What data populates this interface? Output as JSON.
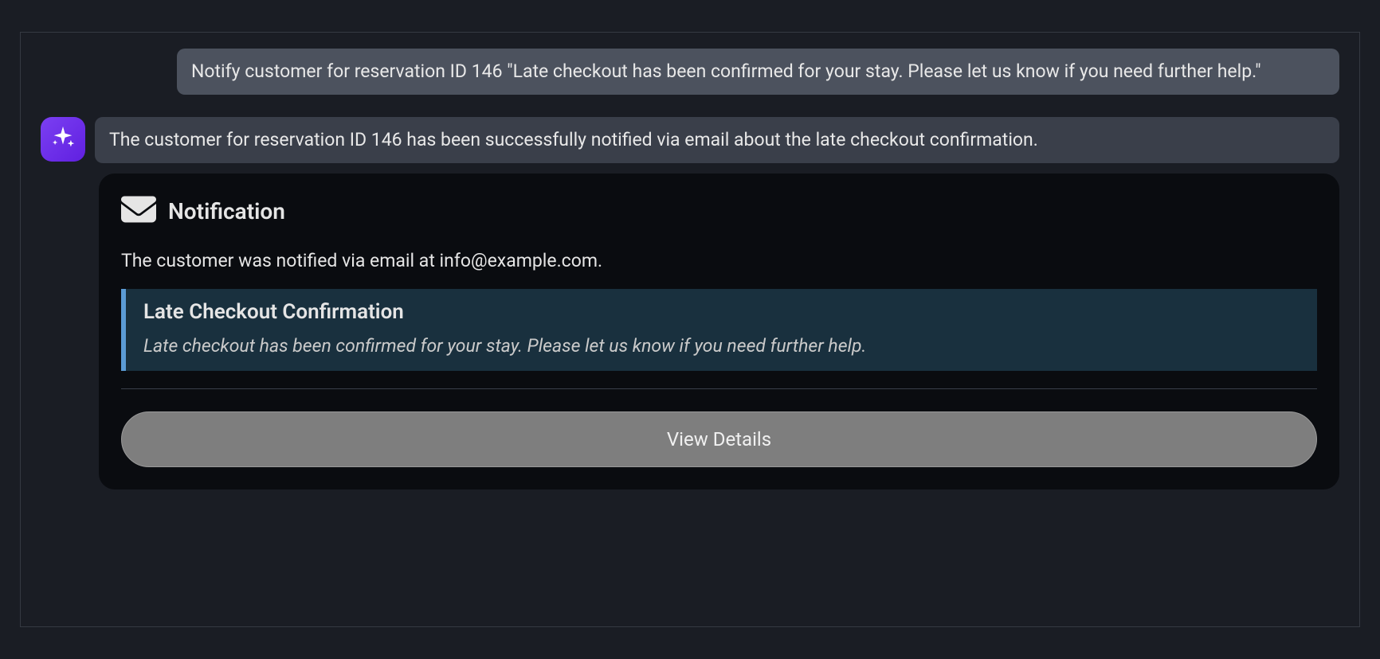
{
  "user_message": "Notify customer for reservation ID 146 \"Late checkout has been confirmed for your stay. Please let us know if you need further help.\"",
  "assistant_message": "The customer for reservation ID 146 has been successfully notified via email about the late checkout confirmation.",
  "notification": {
    "header_title": "Notification",
    "body_text": "The customer was notified via email at info@example.com.",
    "detail_title": "Late Checkout Confirmation",
    "detail_body": "Late checkout has been confirmed for your stay. Please let us know if you need further help.",
    "button_label": "View Details"
  }
}
